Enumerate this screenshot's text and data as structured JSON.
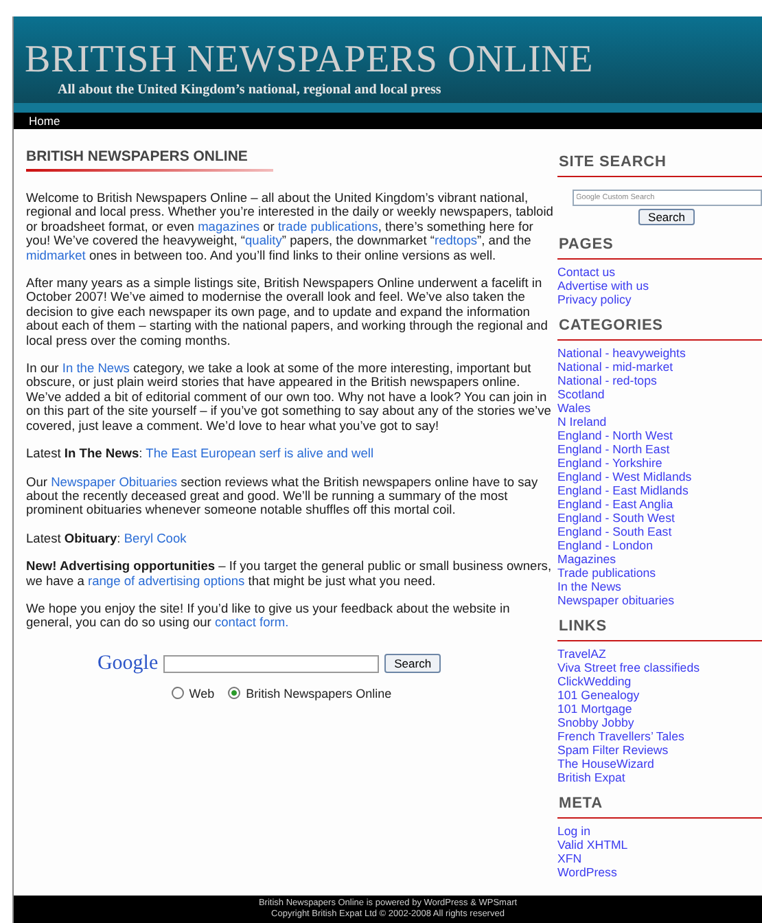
{
  "header": {
    "title": "BRITISH NEWSPAPERS ONLINE",
    "tagline": "All about the United Kingdom’s national, regional and local press"
  },
  "nav": [
    {
      "label": "Home"
    }
  ],
  "main": {
    "heading": "BRITISH NEWSPAPERS ONLINE",
    "paragraphs": [
      {
        "parts": [
          {
            "kind": "text",
            "text": "Welcome to British Newspapers Online – all about the United Kingdom’s vibrant national, regional and local press. Whether you’re interested in the daily or weekly newspapers, tabloid or broadsheet format, or even "
          },
          {
            "kind": "link",
            "text": "magazines"
          },
          {
            "kind": "text",
            "text": " or "
          },
          {
            "kind": "link",
            "text": "trade publications"
          },
          {
            "kind": "text",
            "text": ", there’s something here for you! We’ve covered the heavyweight, “"
          },
          {
            "kind": "link",
            "text": "quality"
          },
          {
            "kind": "text",
            "text": "” papers, the downmarket “"
          },
          {
            "kind": "link",
            "text": "redtops"
          },
          {
            "kind": "text",
            "text": "”, and the "
          },
          {
            "kind": "link",
            "text": "midmarket"
          },
          {
            "kind": "text",
            "text": " ones in between too. And you’ll find links to their online versions as well."
          }
        ]
      },
      {
        "parts": [
          {
            "kind": "text",
            "text": "After many years as a simple listings site, British Newspapers Online underwent a facelift in October 2007! We’ve aimed to modernise the overall look and feel. We’ve also taken the decision to give each newspaper its own page, and to update and expand the information about each of them – starting with the national papers, and working through the regional and local press over the coming months."
          }
        ]
      },
      {
        "parts": [
          {
            "kind": "text",
            "text": "In our "
          },
          {
            "kind": "link",
            "text": "In the News"
          },
          {
            "kind": "text",
            "text": " category, we take a look at some of the more interesting, important but obscure, or just plain weird stories that have appeared in the British newspapers online. We’ve added a bit of editorial comment of our own too. Why not have a look? You can join in on this part of the site yourself – if you’ve got something to say about any of the stories we’ve covered, just leave a comment. We’d love to hear what you’ve got to say!"
          }
        ]
      },
      {
        "parts": [
          {
            "kind": "text",
            "text": "Latest **In The News**: "
          },
          {
            "kind": "link",
            "text": "The East European serf is alive and well"
          }
        ]
      },
      {
        "parts": [
          {
            "kind": "text",
            "text": "Our "
          },
          {
            "kind": "link",
            "text": "Newspaper Obituaries"
          },
          {
            "kind": "text",
            "text": " section reviews what the British newspapers online have to say about the recently deceased great and good. We’ll be running a summary of the most prominent obituaries whenever someone notable shuffles off this mortal coil."
          }
        ]
      },
      {
        "parts": [
          {
            "kind": "text",
            "text": "Latest **Obituary**: "
          },
          {
            "kind": "link",
            "text": "Beryl Cook"
          }
        ]
      },
      {
        "parts": [
          {
            "kind": "text",
            "text": "**New! Advertising opportunities** – If you target the general public or small business owners, we have a "
          },
          {
            "kind": "link",
            "text": "range of advertising options"
          },
          {
            "kind": "text",
            "text": " that might be just what you need."
          }
        ]
      },
      {
        "parts": [
          {
            "kind": "text",
            "text": "We hope you enjoy the site! If you’d like to give us your feedback about the website in general, you can do so using our "
          },
          {
            "kind": "link",
            "text": "contact form."
          }
        ]
      }
    ],
    "search": {
      "logo": "Google",
      "button": "Search",
      "options": [
        {
          "label": "Web",
          "selected": false
        },
        {
          "label": "British Newspapers Online",
          "selected": true
        }
      ]
    }
  },
  "sidebar": {
    "search": {
      "title": "SITE SEARCH",
      "placeholder": "Google Custom Search",
      "button": "Search"
    },
    "sections": [
      {
        "title": "PAGES",
        "items": [
          "Contact us",
          "Advertise with us",
          "Privacy policy"
        ]
      },
      {
        "title": "CATEGORIES",
        "items": [
          "National - heavyweights",
          "National - mid-market",
          "National - red-tops",
          "Scotland",
          "Wales",
          "N Ireland",
          "England - North West",
          "England - North East",
          "England - Yorkshire",
          "England - West Midlands",
          "England - East Midlands",
          "England - East Anglia",
          "England - South West",
          "England - South East",
          "England - London",
          "Magazines",
          "Trade publications",
          "In the News",
          "Newspaper obituaries"
        ]
      },
      {
        "title": "LINKS",
        "items": [
          "TravelAZ",
          "Viva Street free classifieds",
          "ClickWedding",
          "101 Genealogy",
          "101 Mortgage",
          "Snobby Jobby",
          "French Travellers’ Tales",
          "Spam Filter Reviews",
          "The HouseWizard",
          "British Expat"
        ]
      },
      {
        "title": "META",
        "items": [
          "Log in",
          "Valid XHTML",
          "XFN",
          "WordPress"
        ]
      }
    ]
  },
  "footer": {
    "lines": [
      "British Newspapers Online is powered by WordPress & WPSmart",
      "Copyright British Expat Ltd © 2002-2008 All rights reserved"
    ]
  }
}
